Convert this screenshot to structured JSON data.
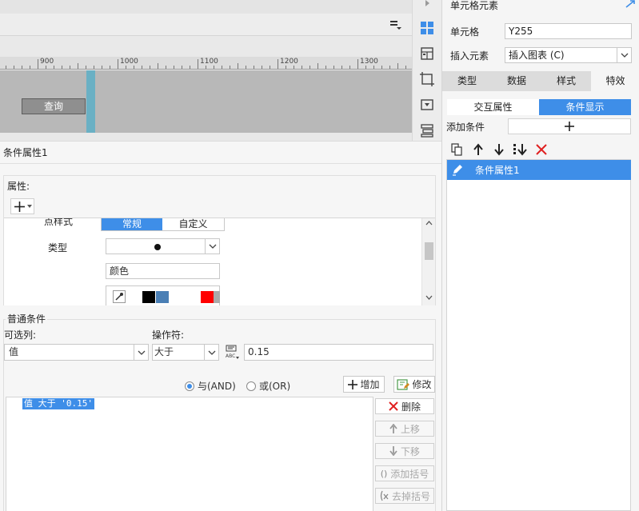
{
  "designer": {
    "ruler_labels": [
      "900",
      "1000",
      "1100",
      "1200",
      "1300"
    ],
    "query_button_label": "查询"
  },
  "right_panel": {
    "title": "单元格元素",
    "cell_label": "单元格",
    "cell_value": "Y255",
    "insert_label": "插入元素",
    "insert_value": "插入图表 (C)",
    "tabs": [
      {
        "label": "类型",
        "active": false
      },
      {
        "label": "数据",
        "active": false
      },
      {
        "label": "样式",
        "active": false
      },
      {
        "label": "特效",
        "active": true
      }
    ],
    "subtabs": [
      {
        "label": "交互属性",
        "active": false
      },
      {
        "label": "条件显示",
        "active": true
      }
    ],
    "add_condition_label": "添加条件",
    "list_items": [
      {
        "label": "条件属性1",
        "selected": true
      }
    ]
  },
  "condition_panel": {
    "title": "条件属性1",
    "properties_label": "属性:",
    "point_style_label": "点样式",
    "style_options": [
      "常规",
      "自定义"
    ],
    "type_label": "类型",
    "color_placeholder": "颜色",
    "swatches": [
      "#000000",
      "#4a7fb5",
      "#ffffff",
      "#ff0000",
      "#aaaaaa"
    ],
    "common_conditions_label": "普通条件",
    "optional_column_label": "可选列:",
    "operator_label": "操作符:",
    "column_value": "值",
    "operator_value": "大于",
    "condition_value": "0.15",
    "and_label": "与(AND)",
    "or_label": "或(OR)",
    "add_label": "增加",
    "modify_label": "修改",
    "expression": "值 大于 '0.15'",
    "side_buttons": {
      "delete": "删除",
      "move_up": "上移",
      "move_down": "下移",
      "add_bracket": "添加括号",
      "remove_bracket": "去掉括号"
    }
  },
  "colors": {
    "accent": "#3e8ee8",
    "delete_red": "#e02020",
    "sheet_marker": "#6ab0c4"
  }
}
